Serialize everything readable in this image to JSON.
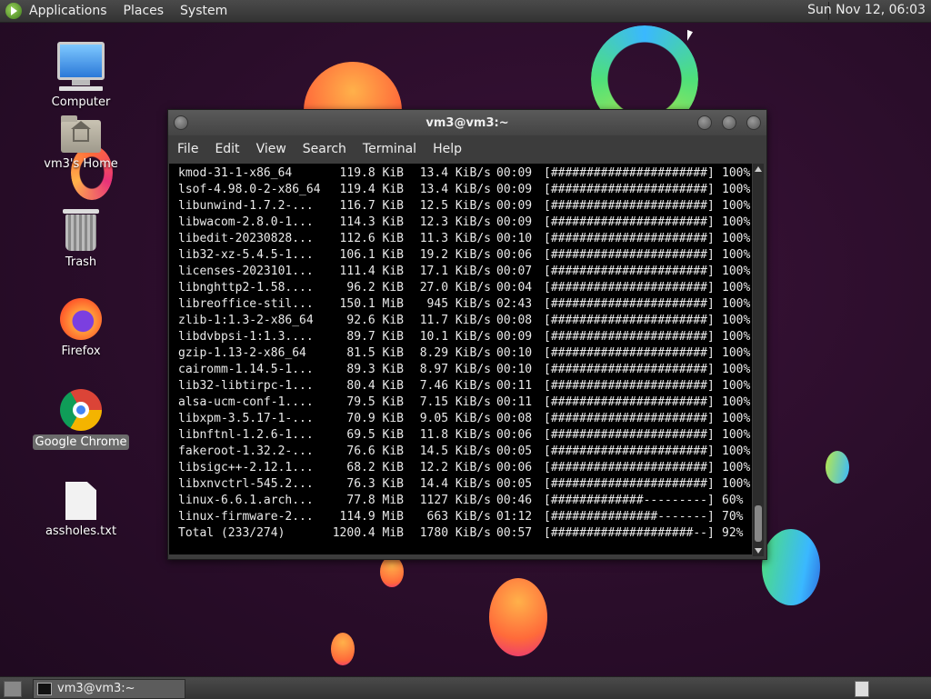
{
  "top_panel": {
    "menus": [
      "Applications",
      "Places",
      "System"
    ],
    "clock": "Sun Nov 12, 06:03"
  },
  "desktop": {
    "icons": [
      {
        "label": "Computer",
        "icon": "computer-icon"
      },
      {
        "label": "vm3's Home",
        "icon": "home-folder-icon"
      },
      {
        "label": "Trash",
        "icon": "trash-icon"
      },
      {
        "label": "Firefox",
        "icon": "firefox-icon"
      },
      {
        "label": "Google Chrome",
        "icon": "chrome-icon",
        "selected": true
      },
      {
        "label": "assholes.txt",
        "icon": "text-file-icon"
      }
    ]
  },
  "terminal": {
    "title": "vm3@vm3:~",
    "menu": [
      "File",
      "Edit",
      "View",
      "Search",
      "Terminal",
      "Help"
    ],
    "rows": [
      {
        "name": "kmod-31-1-x86_64",
        "size": "119.8 KiB",
        "rate": "13.4 KiB/s",
        "time": "00:09",
        "bar": "[######################]",
        "pct": "100%"
      },
      {
        "name": "lsof-4.98.0-2-x86_64",
        "size": "119.4 KiB",
        "rate": "13.4 KiB/s",
        "time": "00:09",
        "bar": "[######################]",
        "pct": "100%"
      },
      {
        "name": "libunwind-1.7.2-...",
        "size": "116.7 KiB",
        "rate": "12.5 KiB/s",
        "time": "00:09",
        "bar": "[######################]",
        "pct": "100%"
      },
      {
        "name": "libwacom-2.8.0-1...",
        "size": "114.3 KiB",
        "rate": "12.3 KiB/s",
        "time": "00:09",
        "bar": "[######################]",
        "pct": "100%"
      },
      {
        "name": "libedit-20230828...",
        "size": "112.6 KiB",
        "rate": "11.3 KiB/s",
        "time": "00:10",
        "bar": "[######################]",
        "pct": "100%"
      },
      {
        "name": "lib32-xz-5.4.5-1...",
        "size": "106.1 KiB",
        "rate": "19.2 KiB/s",
        "time": "00:06",
        "bar": "[######################]",
        "pct": "100%"
      },
      {
        "name": "licenses-2023101...",
        "size": "111.4 KiB",
        "rate": "17.1 KiB/s",
        "time": "00:07",
        "bar": "[######################]",
        "pct": "100%"
      },
      {
        "name": "libnghttp2-1.58....",
        "size": "96.2 KiB",
        "rate": "27.0 KiB/s",
        "time": "00:04",
        "bar": "[######################]",
        "pct": "100%"
      },
      {
        "name": "libreoffice-stil...",
        "size": "150.1 MiB",
        "rate": "945 KiB/s",
        "time": "02:43",
        "bar": "[######################]",
        "pct": "100%"
      },
      {
        "name": "zlib-1:1.3-2-x86_64",
        "size": "92.6 KiB",
        "rate": "11.7 KiB/s",
        "time": "00:08",
        "bar": "[######################]",
        "pct": "100%"
      },
      {
        "name": "libdvbpsi-1:1.3....",
        "size": "89.7 KiB",
        "rate": "10.1 KiB/s",
        "time": "00:09",
        "bar": "[######################]",
        "pct": "100%"
      },
      {
        "name": "gzip-1.13-2-x86_64",
        "size": "81.5 KiB",
        "rate": "8.29 KiB/s",
        "time": "00:10",
        "bar": "[######################]",
        "pct": "100%"
      },
      {
        "name": "cairomm-1.14.5-1...",
        "size": "89.3 KiB",
        "rate": "8.97 KiB/s",
        "time": "00:10",
        "bar": "[######################]",
        "pct": "100%"
      },
      {
        "name": "lib32-libtirpc-1...",
        "size": "80.4 KiB",
        "rate": "7.46 KiB/s",
        "time": "00:11",
        "bar": "[######################]",
        "pct": "100%"
      },
      {
        "name": "alsa-ucm-conf-1....",
        "size": "79.5 KiB",
        "rate": "7.15 KiB/s",
        "time": "00:11",
        "bar": "[######################]",
        "pct": "100%"
      },
      {
        "name": "libxpm-3.5.17-1-...",
        "size": "70.9 KiB",
        "rate": "9.05 KiB/s",
        "time": "00:08",
        "bar": "[######################]",
        "pct": "100%"
      },
      {
        "name": "libnftnl-1.2.6-1...",
        "size": "69.5 KiB",
        "rate": "11.8 KiB/s",
        "time": "00:06",
        "bar": "[######################]",
        "pct": "100%"
      },
      {
        "name": "fakeroot-1.32.2-...",
        "size": "76.6 KiB",
        "rate": "14.5 KiB/s",
        "time": "00:05",
        "bar": "[######################]",
        "pct": "100%"
      },
      {
        "name": "libsigc++-2.12.1...",
        "size": "68.2 KiB",
        "rate": "12.2 KiB/s",
        "time": "00:06",
        "bar": "[######################]",
        "pct": "100%"
      },
      {
        "name": "libxnvctrl-545.2...",
        "size": "76.3 KiB",
        "rate": "14.4 KiB/s",
        "time": "00:05",
        "bar": "[######################]",
        "pct": "100%"
      },
      {
        "name": "linux-6.6.1.arch...",
        "size": "77.8 MiB",
        "rate": "1127 KiB/s",
        "time": "00:46",
        "bar": "[#############---------]",
        "pct": "60%"
      },
      {
        "name": "linux-firmware-2...",
        "size": "114.9 MiB",
        "rate": "663 KiB/s",
        "time": "01:12",
        "bar": "[###############-------]",
        "pct": "70%"
      },
      {
        "name": "Total (233/274)",
        "size": "1200.4 MiB",
        "rate": "1780 KiB/s",
        "time": "00:57",
        "bar": "[####################--]",
        "pct": "92%"
      }
    ]
  },
  "taskbar": {
    "window_label": "vm3@vm3:~"
  },
  "colors": {
    "desktop_bg": "#2a0d2a",
    "panel_bg": "#3c3c3c",
    "terminal_bg": "#000000",
    "terminal_fg": "#eaeaea",
    "accent_orange": "#ff6a3a",
    "accent_green": "#4ee07a"
  }
}
